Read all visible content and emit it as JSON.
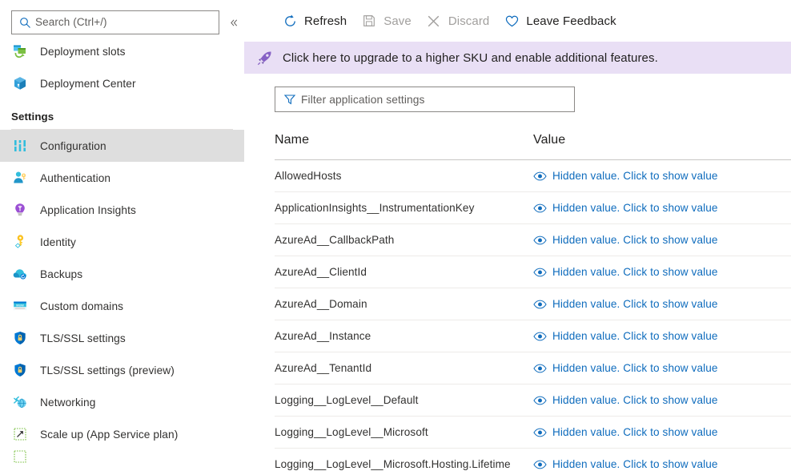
{
  "left_nav": {
    "search": {
      "placeholder": "Search (Ctrl+/)",
      "icon": "search-icon"
    },
    "collapse_icon": "chevron-double-left-icon",
    "top_items": [
      {
        "label": "Deployment slots",
        "icon": "deployment-slots-icon"
      },
      {
        "label": "Deployment Center",
        "icon": "deployment-center-icon"
      }
    ],
    "section_label": "Settings",
    "settings_items": [
      {
        "label": "Configuration",
        "icon": "configuration-icon",
        "selected": true
      },
      {
        "label": "Authentication",
        "icon": "authentication-icon",
        "selected": false
      },
      {
        "label": "Application Insights",
        "icon": "application-insights-icon",
        "selected": false
      },
      {
        "label": "Identity",
        "icon": "identity-key-icon",
        "selected": false
      },
      {
        "label": "Backups",
        "icon": "backups-cloud-icon",
        "selected": false
      },
      {
        "label": "Custom domains",
        "icon": "custom-domains-www-icon",
        "selected": false
      },
      {
        "label": "TLS/SSL settings",
        "icon": "shield-lock-icon",
        "selected": false
      },
      {
        "label": "TLS/SSL settings (preview)",
        "icon": "shield-lock-icon",
        "selected": false
      },
      {
        "label": "Networking",
        "icon": "networking-globe-icon",
        "selected": false
      },
      {
        "label": "Scale up (App Service plan)",
        "icon": "scale-up-icon",
        "selected": false
      }
    ]
  },
  "command_bar": {
    "refresh": {
      "label": "Refresh",
      "icon": "refresh-icon",
      "disabled": false
    },
    "save": {
      "label": "Save",
      "icon": "save-disk-icon",
      "disabled": true
    },
    "discard": {
      "label": "Discard",
      "icon": "discard-x-icon",
      "disabled": true
    },
    "feedback": {
      "label": "Leave Feedback",
      "icon": "heart-icon",
      "disabled": false
    }
  },
  "banner": {
    "icon": "rocket-icon",
    "text": "Click here to upgrade to a higher SKU and enable additional features.",
    "background": "#e9dff5",
    "icon_color": "#8661c5"
  },
  "filter": {
    "icon": "funnel-icon",
    "placeholder": "Filter application settings",
    "value": ""
  },
  "table": {
    "columns": [
      "Name",
      "Value"
    ],
    "hidden_value_text": "Hidden value. Click to show value",
    "value_icon": "eye-icon",
    "link_color": "#0f6cbd",
    "rows": [
      {
        "name": "AllowedHosts",
        "value": "Hidden value. Click to show value"
      },
      {
        "name": "ApplicationInsights__InstrumentationKey",
        "value": "Hidden value. Click to show value"
      },
      {
        "name": "AzureAd__CallbackPath",
        "value": "Hidden value. Click to show value"
      },
      {
        "name": "AzureAd__ClientId",
        "value": "Hidden value. Click to show value"
      },
      {
        "name": "AzureAd__Domain",
        "value": "Hidden value. Click to show value"
      },
      {
        "name": "AzureAd__Instance",
        "value": "Hidden value. Click to show value"
      },
      {
        "name": "AzureAd__TenantId",
        "value": "Hidden value. Click to show value"
      },
      {
        "name": "Logging__LogLevel__Default",
        "value": "Hidden value. Click to show value"
      },
      {
        "name": "Logging__LogLevel__Microsoft",
        "value": "Hidden value. Click to show value"
      },
      {
        "name": "Logging__LogLevel__Microsoft.Hosting.Lifetime",
        "value": "Hidden value. Click to show value"
      }
    ]
  }
}
